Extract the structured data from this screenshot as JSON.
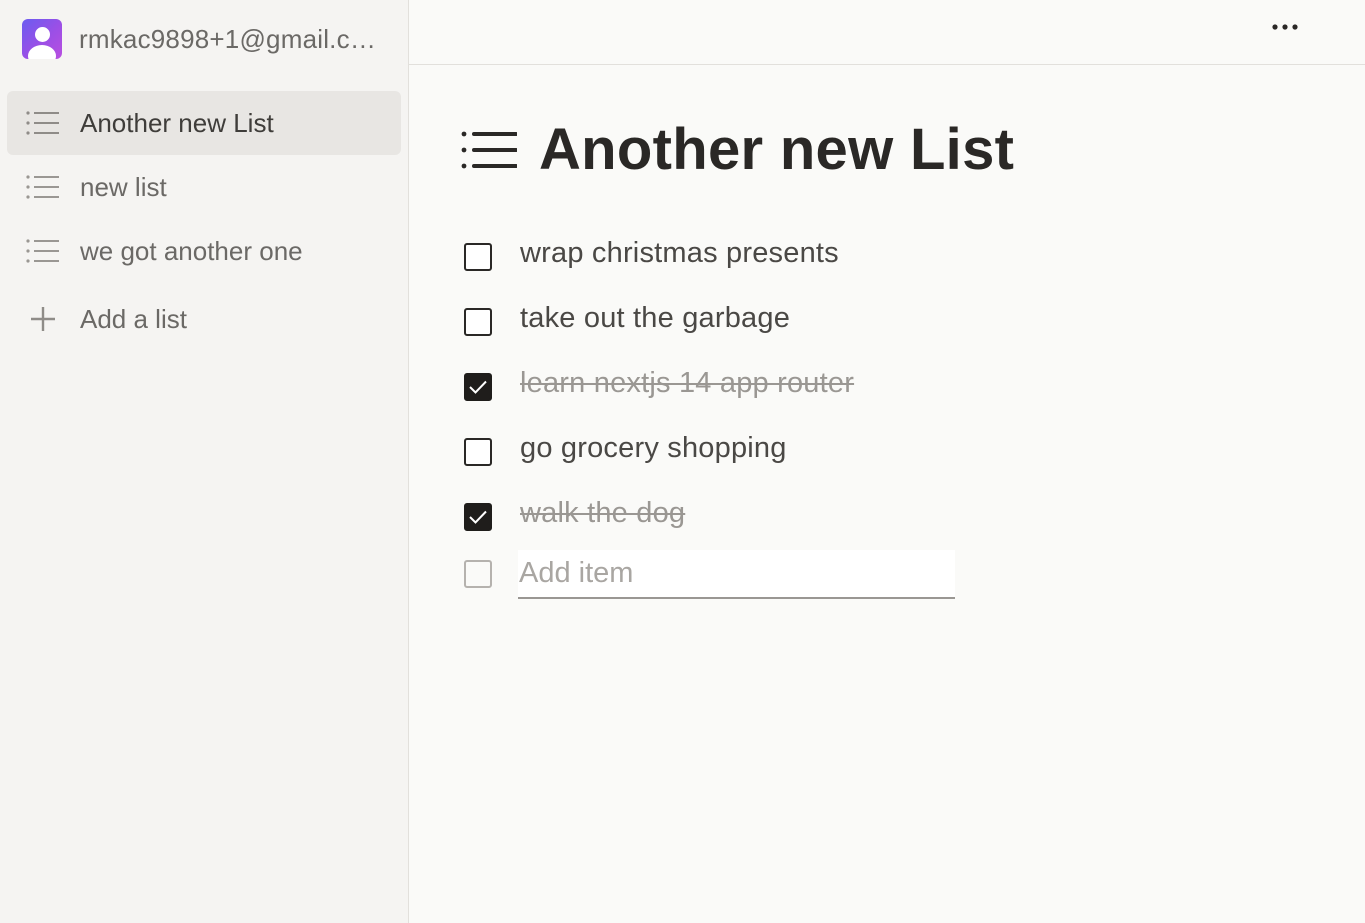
{
  "account": {
    "email": "rmkac9898+1@gmail.com",
    "avatar_icon": "user-avatar-icon",
    "avatar_gradient": [
      "#6b5cf0",
      "#b94fe0"
    ]
  },
  "sidebar": {
    "lists": [
      {
        "label": "Another new List",
        "icon": "list-icon",
        "active": true
      },
      {
        "label": "new list",
        "icon": "list-icon",
        "active": false
      },
      {
        "label": "we got another one",
        "icon": "list-icon",
        "active": false
      }
    ],
    "add_list_label": "Add a list",
    "add_list_icon": "plus-icon"
  },
  "topbar": {
    "more_icon": "more-horizontal-icon"
  },
  "main": {
    "title": "Another new List",
    "title_icon": "list-icon",
    "items": [
      {
        "text": "wrap christmas presents",
        "done": false
      },
      {
        "text": "take out the garbage",
        "done": false
      },
      {
        "text": "learn nextjs 14 app router",
        "done": true
      },
      {
        "text": "go grocery shopping",
        "done": false
      },
      {
        "text": "walk the dog",
        "done": true
      }
    ],
    "add_item_placeholder": "Add item"
  },
  "colors": {
    "sidebar_bg": "#f5f4f2",
    "active_item_bg": "#e8e6e3",
    "main_bg": "#fafaf8",
    "checked_bg": "#1f1d1b",
    "done_text": "#9a9793"
  }
}
